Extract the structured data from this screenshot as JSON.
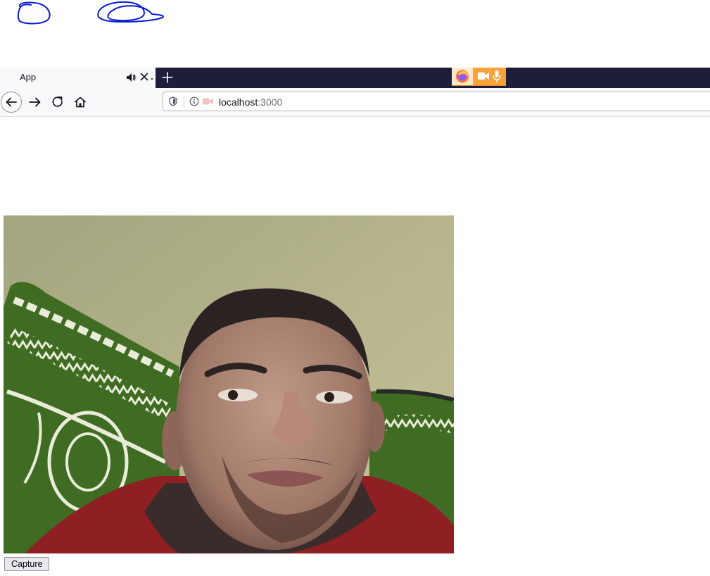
{
  "browser": {
    "tab": {
      "title": "App",
      "audio_icon": "speaker-icon",
      "close_icon": "close-icon"
    },
    "new_tab_icon": "plus-icon",
    "sharing_indicator": {
      "logo_icon": "firefox-logo-icon",
      "camera_icon": "camera-icon",
      "mic_icon": "microphone-icon",
      "color": "#f7a33a"
    },
    "toolbar": {
      "back_icon": "arrow-left-icon",
      "forward_icon": "arrow-right-icon",
      "reload_icon": "reload-icon",
      "home_icon": "home-icon"
    },
    "urlbar": {
      "host": "localhost",
      "port": ":3000",
      "shield_icon": "shield-icon",
      "info_icon": "info-icon",
      "camera_permission_icon": "camera-icon"
    },
    "tabbar_color": "#1f1e3a"
  },
  "page": {
    "webcam_feed": "webcam-video",
    "capture_button": {
      "label": "Capture"
    }
  },
  "annotation": {
    "scribble_color": "#0a1ccf"
  }
}
